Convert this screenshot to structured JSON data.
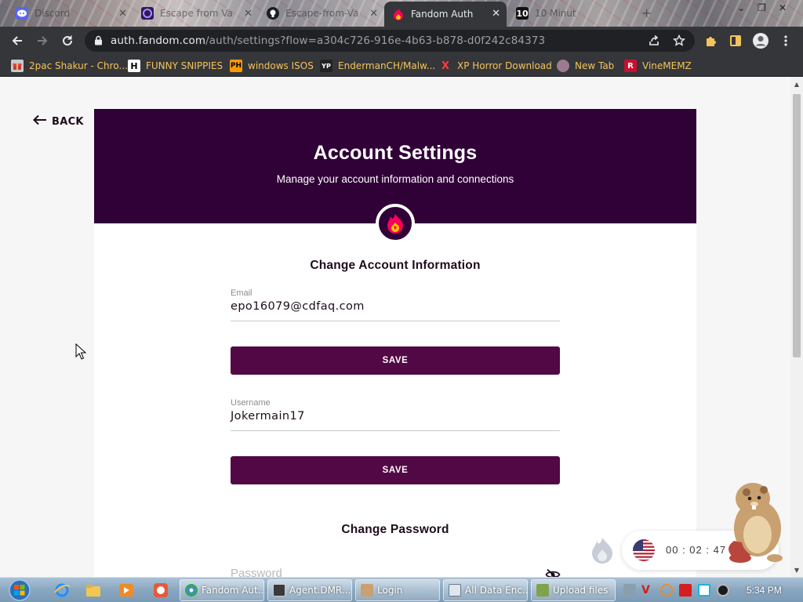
{
  "browser": {
    "tabs": [
      {
        "title": "Discord",
        "active": false
      },
      {
        "title": "Escape from Va",
        "active": false
      },
      {
        "title": "Escape-from-Va",
        "active": false
      },
      {
        "title": "Fandom Auth",
        "active": true
      },
      {
        "title": "10 Minut",
        "active": false
      }
    ],
    "url_host": "auth.fandom.com",
    "url_path": "/auth/settings?flow=a304c726-916e-4b63-b878-d0f242c84373",
    "bookmarks": [
      {
        "label": "2pac Shakur - Chro..."
      },
      {
        "label": "FUNNY SNIPPIES"
      },
      {
        "label": "windows ISOS"
      },
      {
        "label": "EndermanCH/Malw..."
      },
      {
        "label": "XP Horror Download"
      },
      {
        "label": "New Tab"
      },
      {
        "label": "VineMEMZ"
      }
    ]
  },
  "page": {
    "back_label": "BACK",
    "title": "Account Settings",
    "subtitle": "Manage your account information and connections",
    "section_account": "Change Account Information",
    "email": {
      "label": "Email",
      "value": "epo16079@cdfaq.com"
    },
    "email_save": "SAVE",
    "username": {
      "label": "Username",
      "value": "Jokermain17"
    },
    "username_save": "SAVE",
    "section_password": "Change Password",
    "password_placeholder": "Password"
  },
  "widget": {
    "timer": "00 : 02 : 47"
  },
  "taskbar": {
    "tasks": [
      {
        "label": "Fandom Aut..."
      },
      {
        "label": "Agent.DMR..."
      },
      {
        "label": "Login"
      },
      {
        "label": "All Data Enc..."
      },
      {
        "label": "Upload files"
      }
    ],
    "clock": "5:34 PM"
  },
  "colors": {
    "hero": "#300137",
    "button": "#520845",
    "bookmark_text": "#f4c45a"
  }
}
